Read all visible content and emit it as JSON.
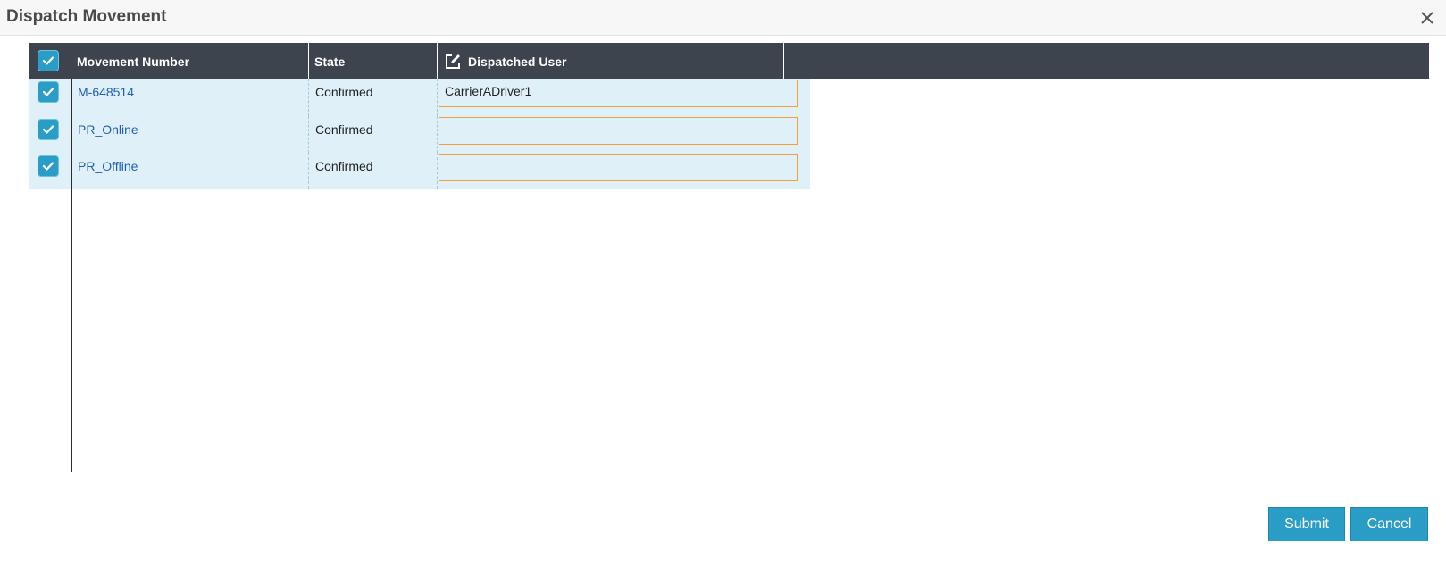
{
  "dialog": {
    "title": "Dispatch Movement"
  },
  "icons": {
    "close": "close-icon",
    "select_all": "checkbox-checked-icon",
    "edit": "edit-icon"
  },
  "colors": {
    "header_bg": "#3d444d",
    "row_bg": "#dff0f8",
    "accent": "#2a9dc7",
    "link": "#1f5fb8",
    "input_border": "#f0a133"
  },
  "grid": {
    "columns": [
      "Movement Number",
      "State",
      "Dispatched User"
    ],
    "rows": [
      {
        "checked": true,
        "movement_number": "M-648514",
        "state": "Confirmed",
        "dispatched_user": "CarrierADriver1"
      },
      {
        "checked": true,
        "movement_number": "PR_Online",
        "state": "Confirmed",
        "dispatched_user": ""
      },
      {
        "checked": true,
        "movement_number": "PR_Offline",
        "state": "Confirmed",
        "dispatched_user": ""
      }
    ]
  },
  "buttons": {
    "submit": "Submit",
    "cancel": "Cancel"
  }
}
